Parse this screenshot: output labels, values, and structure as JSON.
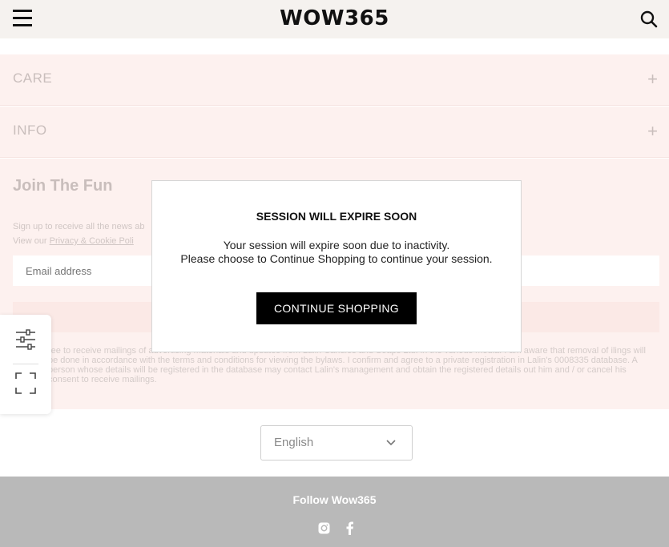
{
  "header": {
    "logo": "WOW365",
    "menu_icon": "hamburger-icon",
    "search_icon": "search-icon"
  },
  "accordion": [
    {
      "label": "CARE",
      "toggle": "+"
    },
    {
      "label": "INFO",
      "toggle": "+"
    }
  ],
  "newsletter": {
    "title": "Join The Fun",
    "line1": "Sign up to receive all the news ab",
    "line2_prefix": "View our ",
    "policy_link": "Privacy & Cookie Poli",
    "email_placeholder": "Email address",
    "legal": "ree to receive mailings of advertising materials and updates from Lalin Candles and Soaps Ltd. in the various media. I am aware that removal of ilings will be done in accordance with the terms and conditions for viewing the bylaws. I confirm and agree to a private registration in Lalin's 0008335 database. A person whose details will be registered in the database may contact Lalin's management and obtain the registered details out him and / or cancel his consent to receive mailings."
  },
  "side_widget": {
    "filter_icon": "sliders-icon",
    "expand_icon": "fullscreen-icon"
  },
  "language": {
    "selected": "English",
    "chevron_icon": "chevron-down-icon"
  },
  "footer": {
    "follow": "Follow Wow365",
    "social": [
      "instagram-icon",
      "facebook-icon"
    ]
  },
  "modal": {
    "title": "SESSION WILL EXPIRE SOON",
    "line1": "Your session will expire soon due to inactivity.",
    "line2": "Please choose to Continue Shopping to continue your session.",
    "button": "CONTINUE SHOPPING"
  },
  "colors": {
    "header_bg": "#f5f2ef",
    "pink_bg": "#fdf1ef",
    "footer_bg": "#b9b9b9",
    "button_bg": "#000000"
  }
}
